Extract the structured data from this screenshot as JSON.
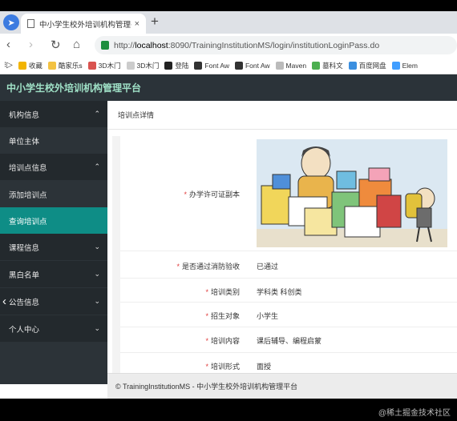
{
  "browser": {
    "tab_title": "中小学生校外培训机构管理平台",
    "tab_close": "×",
    "new_tab": "+",
    "url_prefix": "http://",
    "url_host": "localhost",
    "url_rest": ":8090/TrainingInstitutionMS/login/institutionLoginPass.do"
  },
  "bookmarks": [
    {
      "label": "收藏",
      "icon": "star-icon",
      "color": "#f2b400"
    },
    {
      "label": "酷家乐s",
      "icon": "folder-icon",
      "color": "#f3c242"
    },
    {
      "label": "3D木门",
      "icon": "site-icon",
      "color": "#d9534f"
    },
    {
      "label": "3D木门",
      "icon": "site-icon",
      "color": "#cccccc"
    },
    {
      "label": "登陆",
      "icon": "github-icon",
      "color": "#222222"
    },
    {
      "label": "Font Aw",
      "icon": "flag-icon",
      "color": "#333333"
    },
    {
      "label": "Font Aw",
      "icon": "flag-icon",
      "color": "#333333"
    },
    {
      "label": "Maven",
      "icon": "page-icon",
      "color": "#bbbbbb"
    },
    {
      "label": "墓科文",
      "icon": "grid-icon",
      "color": "#4caf50"
    },
    {
      "label": "百度网盘",
      "icon": "cloud-icon",
      "color": "#3b8fe0"
    },
    {
      "label": "Elem",
      "icon": "element-icon",
      "color": "#409eff"
    }
  ],
  "app": {
    "title": "中小学生校外培训机构管理平台",
    "accent": "#0e8d86"
  },
  "sidebar": {
    "items": [
      {
        "label": "机构信息",
        "type": "group",
        "chevron": "⌃"
      },
      {
        "label": "单位主体",
        "type": "item"
      },
      {
        "label": "培训点信息",
        "type": "group",
        "chevron": "⌃"
      },
      {
        "label": "添加培训点",
        "type": "item"
      },
      {
        "label": "查询培训点",
        "type": "active"
      },
      {
        "label": "课程信息",
        "type": "group",
        "chevron": "⌄"
      },
      {
        "label": "黑白名单",
        "type": "group",
        "chevron": "⌄"
      },
      {
        "label": "公告信息",
        "type": "group",
        "chevron": "⌄"
      },
      {
        "label": "个人中心",
        "type": "group",
        "chevron": "⌄"
      }
    ]
  },
  "main": {
    "breadcrumb": "培训点详情",
    "fields": [
      {
        "label": "办学许可证副本",
        "value": ""
      },
      {
        "label": "是否通过消防验收",
        "value": "已通过"
      },
      {
        "label": "培训类别",
        "value": "学科类 科创类"
      },
      {
        "label": "招生对象",
        "value": "小学生"
      },
      {
        "label": "培训内容",
        "value": "课后辅导、编程启蒙"
      },
      {
        "label": "培训形式",
        "value": "面授"
      }
    ],
    "required_mark": "*"
  },
  "footer": {
    "text": "© TrainingInstitutionMS - 中小学生校外培训机构管理平台"
  },
  "watermark": "@稀土掘金技术社区"
}
